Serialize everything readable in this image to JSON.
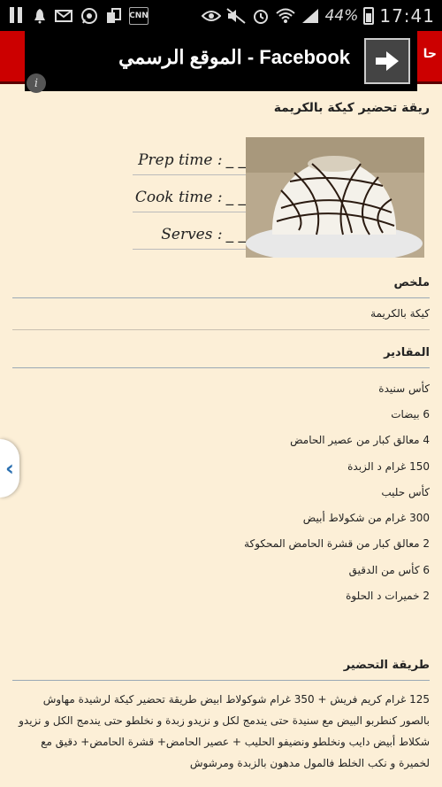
{
  "status_bar": {
    "battery_percent": "44%",
    "time": "17:41",
    "icons": [
      "pause-icon",
      "bell-icon",
      "mail-icon",
      "whatsapp-icon",
      "copy-icon",
      "cnn-icon",
      "eye-icon",
      "mute-icon",
      "alarm-icon",
      "wifi-icon",
      "signal-icon",
      "battery-icon"
    ],
    "cnn_label": "CNN"
  },
  "header": {
    "title_fragment": "حا"
  },
  "ad": {
    "text": "Facebook - الموقع الرسمي",
    "arrow_icon": "arrow-right-icon",
    "info_icon": "info-icon",
    "info_glyph": "i"
  },
  "recipe": {
    "title": "ريقة تحضير كيكة بالكريمة",
    "prep_label": "Prep time :",
    "cook_label": "Cook time :",
    "serves_label": "Serves :",
    "blank": "_ _"
  },
  "summary": {
    "heading": "ملخص",
    "text": "كيكة بالكريمة"
  },
  "ingredients": {
    "heading": "المقادير",
    "items": [
      "كأس سنيدة",
      "6 بيضات",
      "4 معالق كبار من عصير الحامض",
      "150 غرام د الزبدة",
      "كأس حليب",
      "300 غرام من شكولاط أبيض",
      "2 معالق كبار من قشرة الحامض المحكوكة",
      "6 كأس من الدقيق",
      "2 خميرات د الحلوة"
    ]
  },
  "method": {
    "heading": "طريقة التحضير",
    "text": "125 غرام كريم فريش + 350 غرام شوكولاط ابيض طريقة تحضير كيكة لرشيدة مهاوش بالصور كنطربو البيض مع سنيدة حتى يندمج لكل و نزيدو زبدة و نخلطو حتى يندمج الكل و نزيدو شكلاط أبيض دايب ونخلطو ونضيفو الحليب + عصير الحامض+ قشرة الحامض+ دقيق مع لخميرة و نكب الخلط فالمول مدهون بالزبدة ومرشوش"
  },
  "side_tab": {
    "glyph": "‹"
  }
}
